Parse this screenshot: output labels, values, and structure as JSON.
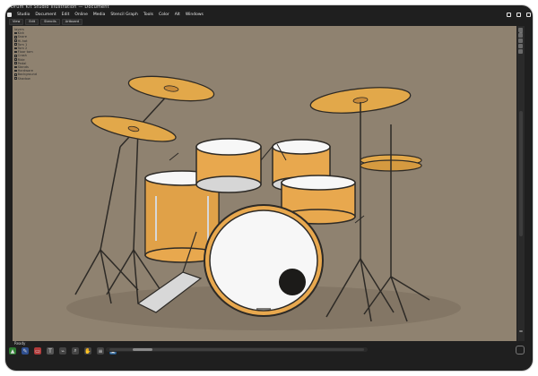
{
  "window": {
    "title": "Drum Kit Studio Illustration — Document"
  },
  "menubar": {
    "items": [
      "Studio",
      "Document",
      "Edit",
      "Online",
      "Media",
      "Stencil Graph",
      "Tools",
      "Color",
      "Alt",
      "Windows"
    ]
  },
  "tabs": {
    "items": [
      "View",
      "Edit",
      "Stencils",
      "Artboard"
    ]
  },
  "sidebar": {
    "header": "layers",
    "items": [
      "Kick",
      "Snare",
      "Hi-hat",
      "Tom 1",
      "Tom 2",
      "Floor tom",
      "Crash",
      "Ride",
      "Pedal",
      "Stands",
      "Hardware",
      "Background",
      "Shadow"
    ]
  },
  "bottombar": {
    "status": "Ready",
    "icons": [
      "select-icon",
      "pen-icon",
      "rectangle-icon",
      "text-icon",
      "eyedropper-icon",
      "zoom-icon",
      "hand-icon",
      "layers-icon",
      "image-icon"
    ]
  },
  "colors": {
    "canvas_bg": "#8f8270",
    "frame": "#1f1f1f",
    "drum_shell": "#e8a84e",
    "drum_shell_shadow": "#c98b39",
    "drum_head": "#f7f7f7",
    "cymbal": "#e2a84a",
    "metal": "#d8d8d8",
    "outline": "#2d2a26"
  }
}
